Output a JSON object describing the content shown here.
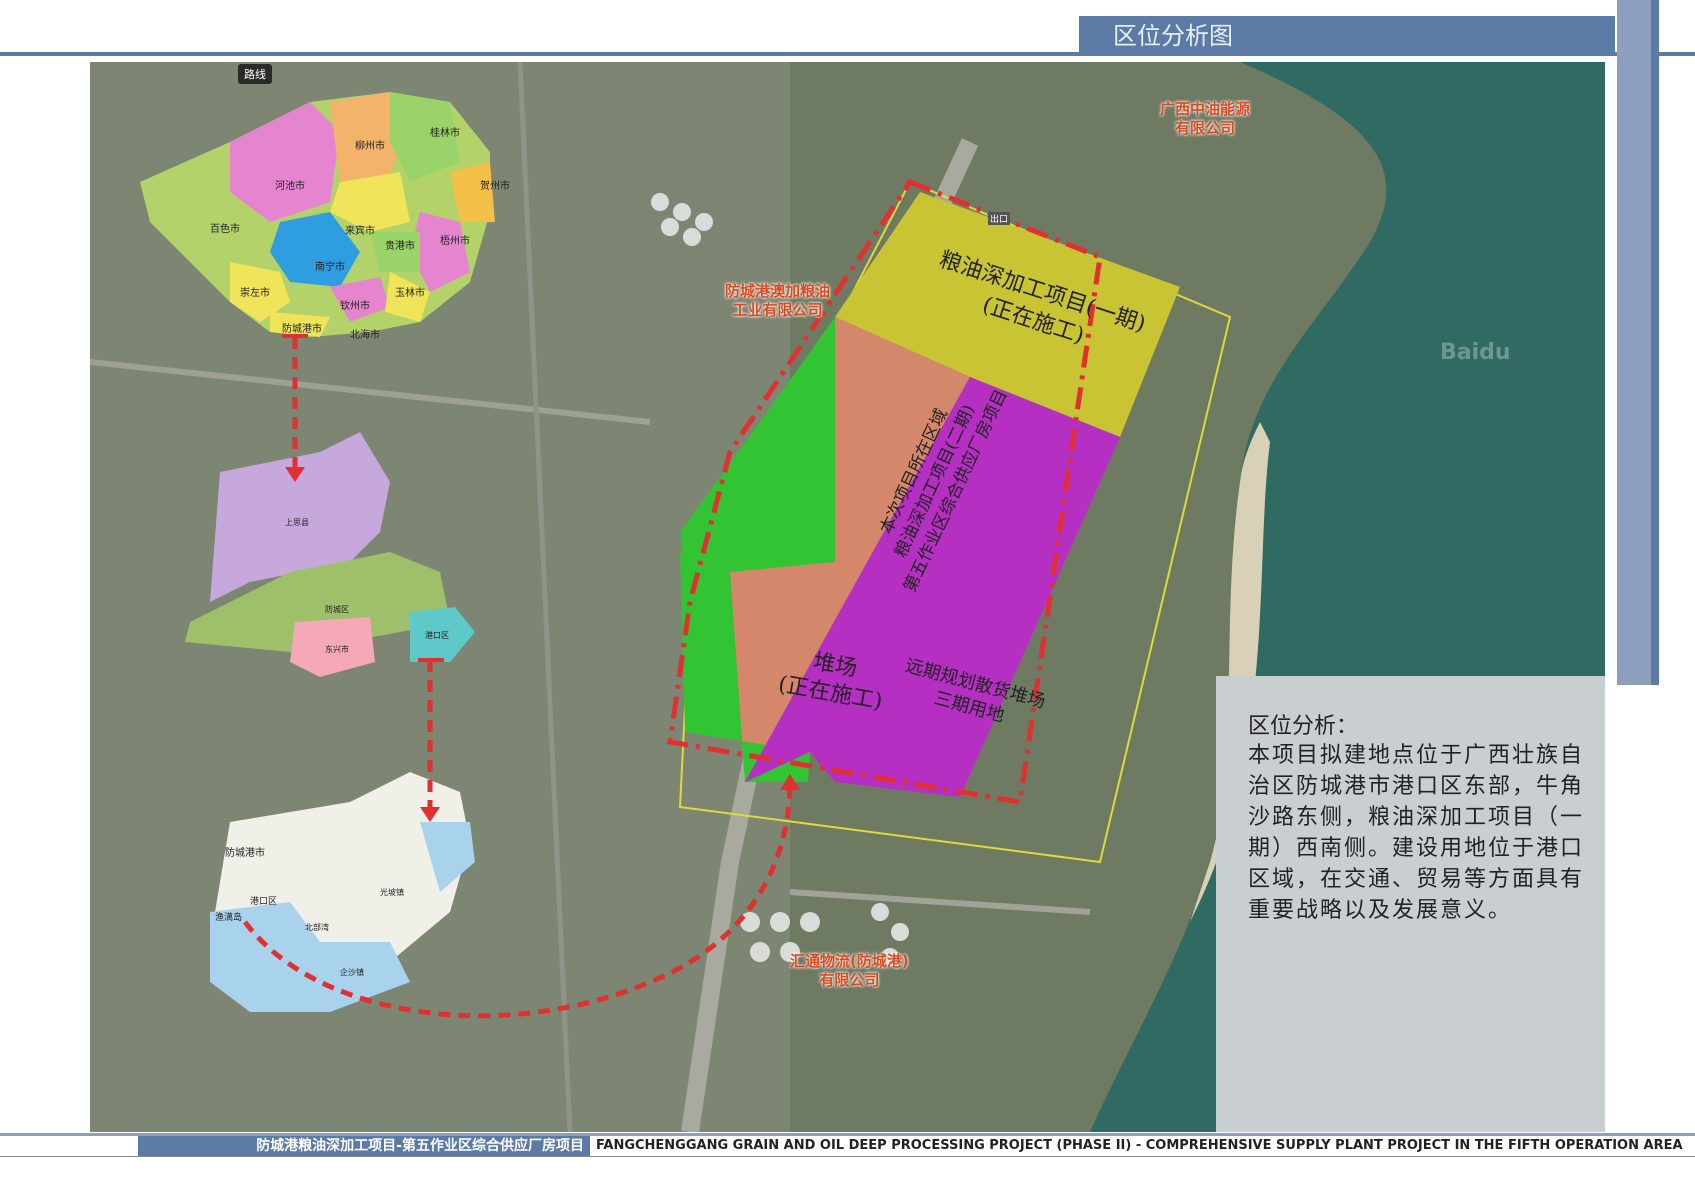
{
  "header": {
    "title": "区位分析图"
  },
  "map_labels": {
    "road_badge": "路线",
    "company_1": "广西中油能源\n有限公司",
    "company_2": "防城港澳加粮油\n工业有限公司",
    "company_3": "汇通物流(防城港)\n有限公司",
    "watermark": "Baidu"
  },
  "zones": {
    "phase1": "粮油深加工项目(一期)\n(正在施工)",
    "current_project": "本次项目所在区域\n粮油深加工项目(二期)\n第五作业区综合供应厂房项目",
    "yard": "堆场\n(正在施工)",
    "future": "远期规划散货堆场\n三期用地",
    "gate": "出口"
  },
  "province_map": {
    "cities": [
      "桂林市",
      "柳州市",
      "河池市",
      "贺州市",
      "百色市",
      "来宾市",
      "贵港市",
      "梧州市",
      "南宁市",
      "崇左市",
      "钦州市",
      "玉林市",
      "防城港市",
      "北海市"
    ]
  },
  "district_map": {
    "districts": [
      "上思县",
      "防城区",
      "东兴市",
      "港口区"
    ]
  },
  "local_map": {
    "places": [
      "防城港市",
      "港口区",
      "渔澫岛",
      "北部湾",
      "企沙镇",
      "光坡镇"
    ]
  },
  "analysis": {
    "title": "区位分析：",
    "text": "本项目拟建地点位于广西壮族自治区防城港市港口区东部，牛角沙路东侧，粮油深加工项目（一期）西南侧。建设用地位于港口区域，在交通、贸易等方面具有重要战略以及发展意义。"
  },
  "footer": {
    "cn": "防城港粮油深加工项目-第五作业区综合供应厂房项目",
    "en": "FANGCHENGGANG GRAIN AND OIL DEEP PROCESSING PROJECT (PHASE II) - COMPREHENSIVE SUPPLY PLANT PROJECT IN THE FIFTH OPERATION AREA"
  },
  "colors": {
    "accent": "#5b7aa6",
    "phase1": "#c9c433",
    "current": "#d4876a",
    "yard": "#33c433",
    "future": "#b52fc2",
    "boundary": "#e03030"
  }
}
